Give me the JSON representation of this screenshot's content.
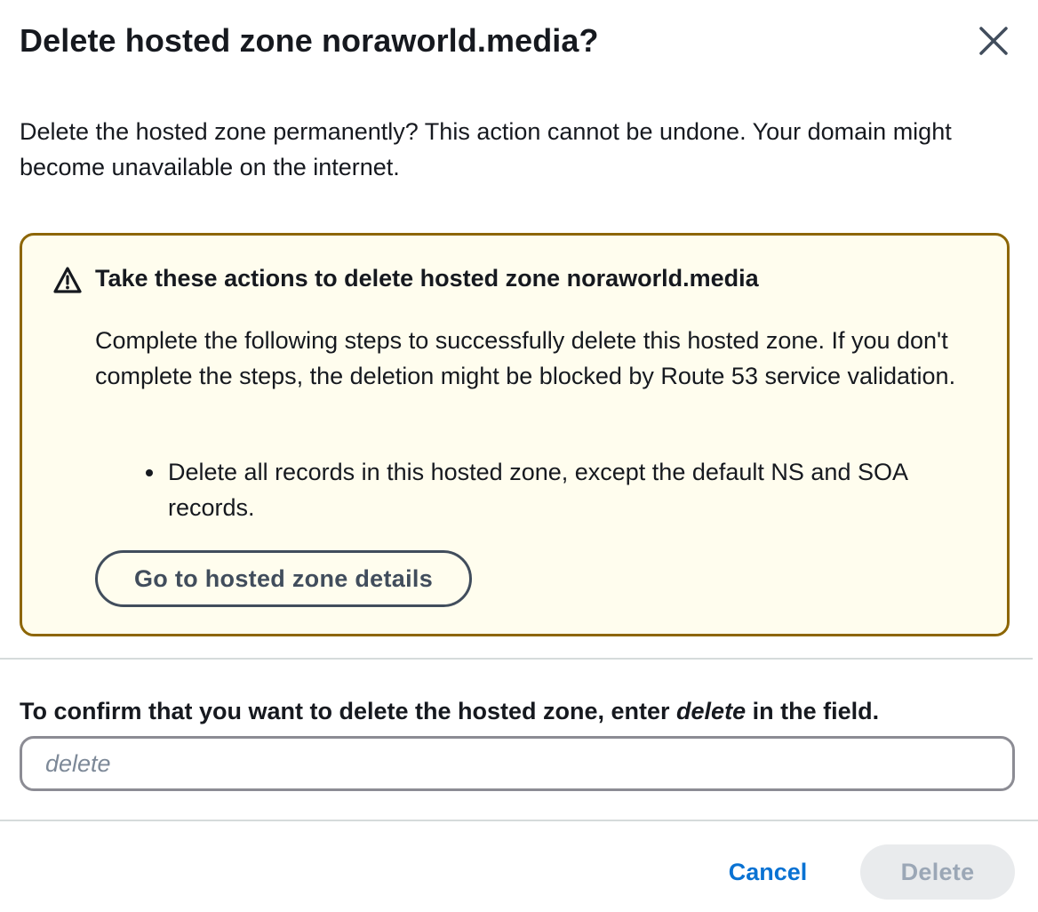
{
  "dialog": {
    "title": "Delete hosted zone noraworld.media?",
    "close_icon": "close-icon",
    "intro": "Delete the hosted zone permanently? This action cannot be undone. Your domain might become unavailable on the internet."
  },
  "alert": {
    "type": "warning",
    "icon": "warning-triangle-icon",
    "heading": "Take these actions to delete hosted zone noraworld.media",
    "body": "Complete the following steps to successfully delete this hosted zone. If you don't complete the steps, the deletion might be blocked by Route 53 service validation.",
    "steps": [
      "Delete all records in this hosted zone, except the default NS and SOA records."
    ],
    "button_label": "Go to hosted zone details",
    "colors": {
      "background": "#fffdee",
      "border": "#8d6605"
    }
  },
  "confirm": {
    "label_before": "To confirm that you want to delete the hosted zone, enter ",
    "label_keyword": "delete",
    "label_after": " in the field.",
    "input_value": "",
    "input_placeholder": "delete"
  },
  "footer": {
    "cancel_label": "Cancel",
    "delete_label": "Delete",
    "delete_disabled": true,
    "colors": {
      "link": "#0972d3",
      "disabled_bg": "#e9ebed",
      "disabled_text": "#9ba7b6"
    }
  }
}
